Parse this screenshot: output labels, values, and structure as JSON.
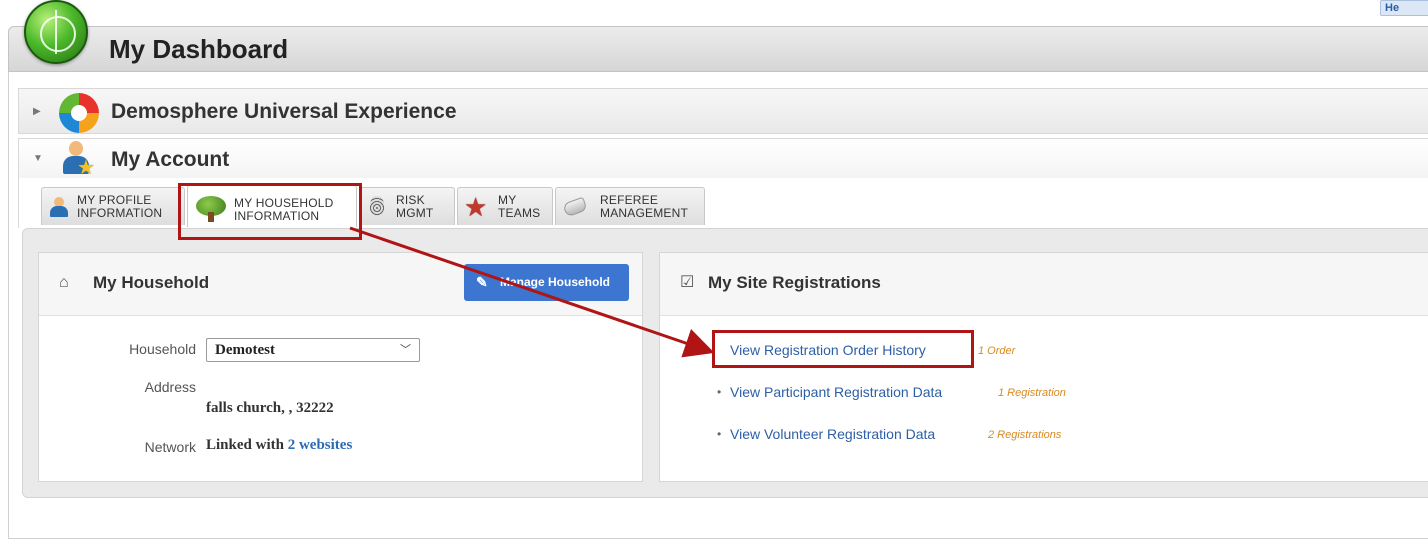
{
  "help_chip": {
    "label": "He"
  },
  "dashboard": {
    "title": "My Dashboard"
  },
  "sections": {
    "universal": {
      "title": "Demosphere Universal Experience"
    },
    "account": {
      "title": "My Account"
    }
  },
  "tabs": [
    {
      "label": "MY PROFILE\nINFORMATION",
      "active": false
    },
    {
      "label": "MY HOUSEHOLD\nINFORMATION",
      "active": true
    },
    {
      "label": "RISK\nMGMT",
      "active": false
    },
    {
      "label": "MY\nTEAMS",
      "active": false
    },
    {
      "label": "REFEREE\nMANAGEMENT",
      "active": false
    }
  ],
  "household": {
    "title": "My Household",
    "manage_label": "Manage Household",
    "household_label": "Household",
    "household_value": "Demotest",
    "address_label": "Address",
    "address_value": "falls church, , 32222",
    "network_label": "Network",
    "network_prefix": "Linked with",
    "network_link": "2 websites"
  },
  "registrations": {
    "title": "My Site Registrations",
    "items": [
      {
        "link": "View Registration Order History",
        "count": "1 Order"
      },
      {
        "link": "View Participant Registration Data",
        "count": "1 Registration"
      },
      {
        "link": "View Volunteer Registration Data",
        "count": "2 Registrations"
      }
    ]
  },
  "colors": {
    "accent_blue": "#3c76d1",
    "link_blue": "#2d5ea6",
    "count_orange": "#d98a1e",
    "callout_red": "#b01414"
  }
}
